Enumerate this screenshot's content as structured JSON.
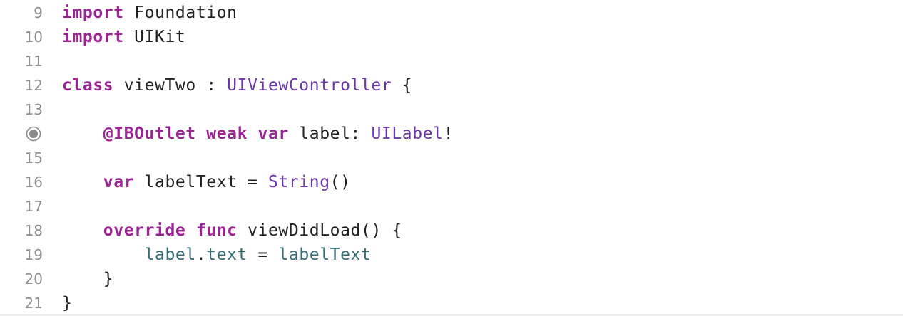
{
  "editor": {
    "lines": [
      {
        "num": "9",
        "tokens": [
          [
            "kw",
            "import"
          ],
          [
            "pl",
            " Foundation"
          ]
        ]
      },
      {
        "num": "10",
        "tokens": [
          [
            "kw",
            "import"
          ],
          [
            "pl",
            " UIKit"
          ]
        ]
      },
      {
        "num": "11",
        "tokens": []
      },
      {
        "num": "12",
        "tokens": [
          [
            "kw",
            "class"
          ],
          [
            "pl",
            " viewTwo : "
          ],
          [
            "ty",
            "UIViewController"
          ],
          [
            "pl",
            " {"
          ]
        ]
      },
      {
        "num": "13",
        "tokens": []
      },
      {
        "num": "",
        "outlet": true,
        "tokens": [
          [
            "pl",
            "    "
          ],
          [
            "kw",
            "@IBOutlet"
          ],
          [
            "pl",
            " "
          ],
          [
            "kw",
            "weak"
          ],
          [
            "pl",
            " "
          ],
          [
            "kw",
            "var"
          ],
          [
            "pl",
            " label: "
          ],
          [
            "ty",
            "UILabel"
          ],
          [
            "pl",
            "!"
          ]
        ]
      },
      {
        "num": "15",
        "tokens": []
      },
      {
        "num": "16",
        "tokens": [
          [
            "pl",
            "    "
          ],
          [
            "kw",
            "var"
          ],
          [
            "pl",
            " labelText = "
          ],
          [
            "ty",
            "String"
          ],
          [
            "pl",
            "()"
          ]
        ]
      },
      {
        "num": "17",
        "tokens": []
      },
      {
        "num": "18",
        "tokens": [
          [
            "pl",
            "    "
          ],
          [
            "kw",
            "override"
          ],
          [
            "pl",
            " "
          ],
          [
            "kw",
            "func"
          ],
          [
            "pl",
            " viewDidLoad() {"
          ]
        ]
      },
      {
        "num": "19",
        "tokens": [
          [
            "pl",
            "        "
          ],
          [
            "pr",
            "label"
          ],
          [
            "pl",
            "."
          ],
          [
            "pr",
            "text"
          ],
          [
            "pl",
            " = "
          ],
          [
            "pr",
            "labelText"
          ]
        ]
      },
      {
        "num": "20",
        "tokens": [
          [
            "pl",
            "    }"
          ]
        ]
      },
      {
        "num": "21",
        "tokens": [
          [
            "pl",
            "}"
          ]
        ]
      }
    ]
  },
  "colors": {
    "keyword": "#9b2393",
    "type": "#6c36a9",
    "plain": "#1f1f24",
    "property": "#326d74",
    "line_number": "#8f8f8f"
  },
  "icons": {
    "outlet_connection": "outlet-connected-icon"
  }
}
